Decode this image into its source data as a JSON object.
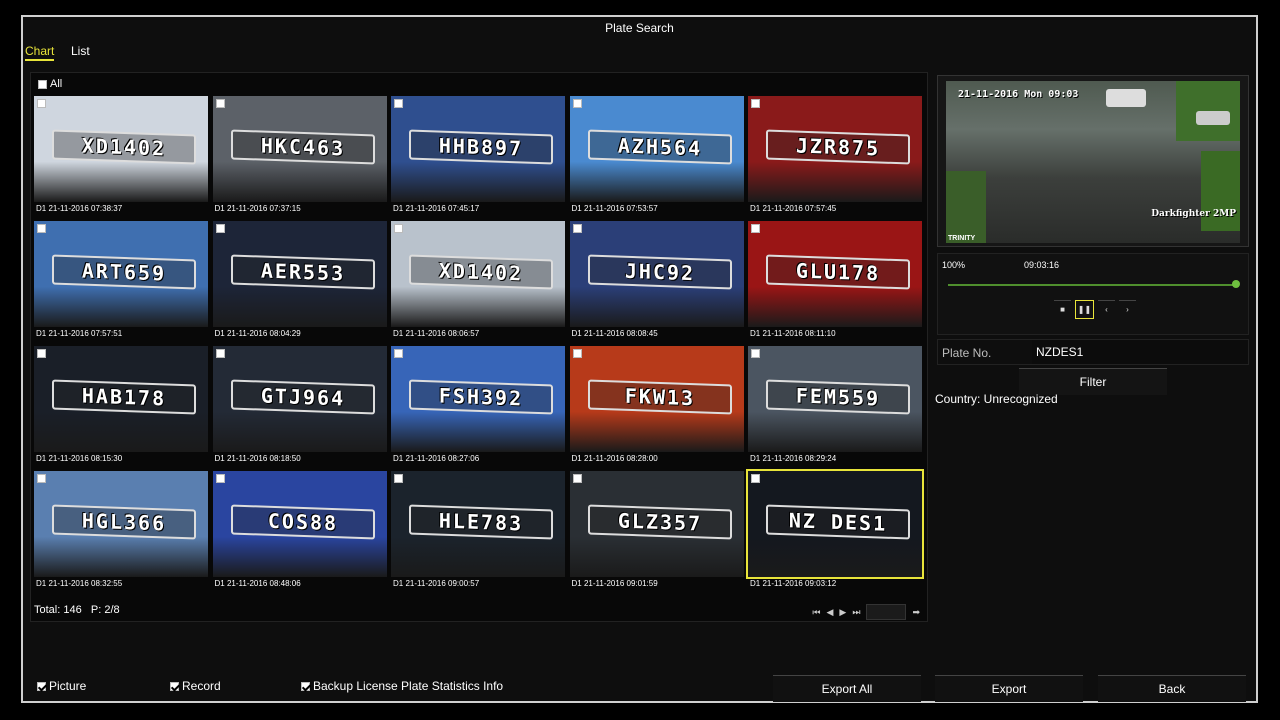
{
  "window": {
    "title": "Plate Search"
  },
  "tabs": [
    {
      "label": "Chart",
      "active": true
    },
    {
      "label": "List",
      "active": false
    }
  ],
  "grid": {
    "select_all_label": "All",
    "tiles": [
      {
        "plate": "XD1402",
        "timestamp": "D1 21-11-2016 07:38:37",
        "color": "#cfd6df",
        "selected": false
      },
      {
        "plate": "HKC463",
        "timestamp": "D1 21-11-2016 07:37:15",
        "color": "#5c6168",
        "selected": false
      },
      {
        "plate": "HHB897",
        "timestamp": "D1 21-11-2016 07:45:17",
        "color": "#2f4f8f",
        "selected": false
      },
      {
        "plate": "AZH564",
        "timestamp": "D1 21-11-2016 07:53:57",
        "color": "#4a8ad0",
        "selected": false
      },
      {
        "plate": "JZR875",
        "timestamp": "D1 21-11-2016 07:57:45",
        "color": "#8a1a1a",
        "selected": false
      },
      {
        "plate": "ART659",
        "timestamp": "D1 21-11-2016 07:57:51",
        "color": "#3f6fb0",
        "selected": false
      },
      {
        "plate": "AER553",
        "timestamp": "D1 21-11-2016 08:04:29",
        "color": "#1d2538",
        "selected": false
      },
      {
        "plate": "XD1402",
        "timestamp": "D1 21-11-2016 08:06:57",
        "color": "#b9c2cc",
        "selected": false
      },
      {
        "plate": "JHC92",
        "timestamp": "D1 21-11-2016 08:08:45",
        "color": "#2b3f78",
        "selected": false
      },
      {
        "plate": "GLU178",
        "timestamp": "D1 21-11-2016 08:11:10",
        "color": "#9a1515",
        "selected": false
      },
      {
        "plate": "HAB178",
        "timestamp": "D1 21-11-2016 08:15:30",
        "color": "#1a1f28",
        "selected": false
      },
      {
        "plate": "GTJ964",
        "timestamp": "D1 21-11-2016 08:18:50",
        "color": "#232a36",
        "selected": false
      },
      {
        "plate": "FSH392",
        "timestamp": "D1 21-11-2016 08:27:06",
        "color": "#3765b8",
        "selected": false
      },
      {
        "plate": "FKW13",
        "timestamp": "D1 21-11-2016 08:28:00",
        "color": "#b73a1a",
        "selected": false
      },
      {
        "plate": "FEM559",
        "timestamp": "D1 21-11-2016 08:29:24",
        "color": "#4b5561",
        "selected": false
      },
      {
        "plate": "HGL366",
        "timestamp": "D1 21-11-2016 08:32:55",
        "color": "#5a7fb0",
        "selected": false
      },
      {
        "plate": "COS88",
        "timestamp": "D1 21-11-2016 08:48:06",
        "color": "#2a45a0",
        "selected": false
      },
      {
        "plate": "HLE783",
        "timestamp": "D1 21-11-2016 09:00:57",
        "color": "#1b232c",
        "selected": false
      },
      {
        "plate": "GLZ357",
        "timestamp": "D1 21-11-2016 09:01:59",
        "color": "#2a2f34",
        "selected": false
      },
      {
        "plate": "NZ DES1",
        "timestamp": "D1 21-11-2016 09:03:12",
        "color": "#14181f",
        "selected": true
      }
    ]
  },
  "footer": {
    "total_label": "Total: 146",
    "page_label": "P: 2/8"
  },
  "pager_icons": [
    "first-page-icon",
    "prev-page-icon",
    "next-page-icon",
    "last-page-icon",
    "go-icon"
  ],
  "preview": {
    "osd_date": "21-11-2016 Mon 09:03",
    "osd_camera": "Darkfighter 2MP",
    "osd_logo": "TRINITY"
  },
  "playback": {
    "speed": "100%",
    "time": "09:03:16",
    "progress": 1.0,
    "controls": [
      "stop-icon",
      "pause-icon",
      "prev-icon",
      "next-icon"
    ]
  },
  "plate_search": {
    "label": "Plate No.",
    "value": "NZDES1",
    "filter_label": "Filter",
    "country": "Country: Unrecognized"
  },
  "options": [
    {
      "label": "Picture",
      "checked": true
    },
    {
      "label": "Record",
      "checked": true
    },
    {
      "label": "Backup License Plate Statistics Info",
      "checked": true
    }
  ],
  "buttons": {
    "export_all": "Export All",
    "export": "Export",
    "back": "Back"
  },
  "colors": {
    "accent": "#e8e43a",
    "progress": "#4f8f2d"
  }
}
